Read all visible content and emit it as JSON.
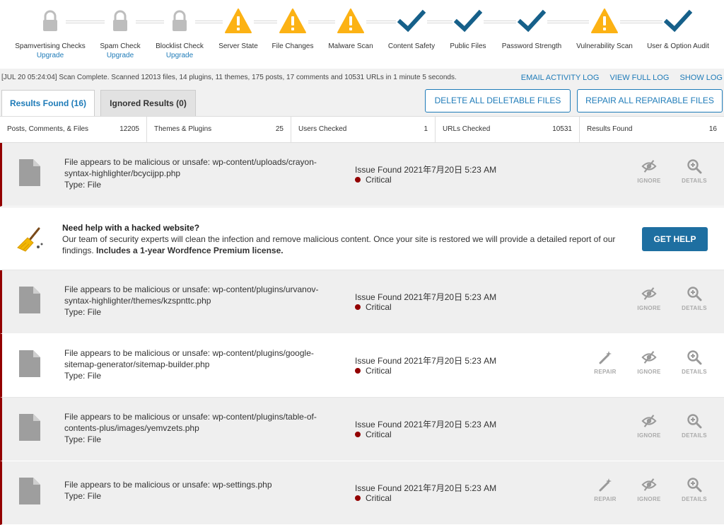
{
  "stages": [
    {
      "label": "Spamvertising Checks",
      "status": "locked",
      "icon": "lock-icon",
      "upgrade": "Upgrade"
    },
    {
      "label": "Spam Check",
      "status": "locked",
      "icon": "lock-icon",
      "upgrade": "Upgrade"
    },
    {
      "label": "Blocklist Check",
      "status": "locked",
      "icon": "lock-icon",
      "upgrade": "Upgrade"
    },
    {
      "label": "Server State",
      "status": "warning",
      "icon": "warning-icon"
    },
    {
      "label": "File Changes",
      "status": "warning",
      "icon": "warning-icon"
    },
    {
      "label": "Malware Scan",
      "status": "warning",
      "icon": "warning-icon"
    },
    {
      "label": "Content Safety",
      "status": "ok",
      "icon": "checkmark-icon"
    },
    {
      "label": "Public Files",
      "status": "ok",
      "icon": "checkmark-icon"
    },
    {
      "label": "Password Strength",
      "status": "ok",
      "icon": "checkmark-icon"
    },
    {
      "label": "Vulnerability Scan",
      "status": "warning",
      "icon": "warning-icon"
    },
    {
      "label": "User & Option Audit",
      "status": "ok",
      "icon": "checkmark-icon"
    }
  ],
  "log": {
    "message": "[JUL 20 05:24:04] Scan Complete. Scanned 12013 files, 14 plugins, 11 themes, 175 posts, 17 comments and 10531 URLs in 1 minute 5 seconds.",
    "email_activity": "EMAIL ACTIVITY LOG",
    "view_full": "VIEW FULL LOG",
    "show": "SHOW LOG"
  },
  "tabs": {
    "results": "Results Found (16)",
    "ignored": "Ignored Results (0)"
  },
  "actions": {
    "delete_all": "DELETE ALL DELETABLE FILES",
    "repair_all": "REPAIR ALL REPAIRABLE FILES"
  },
  "summary": [
    {
      "label": "Posts, Comments, & Files",
      "value": "12205"
    },
    {
      "label": "Themes & Plugins",
      "value": "25"
    },
    {
      "label": "Users Checked",
      "value": "1"
    },
    {
      "label": "URLs Checked",
      "value": "10531"
    },
    {
      "label": "Results Found",
      "value": "16"
    }
  ],
  "issues": [
    {
      "title": "File appears to be malicious or unsafe: wp-content/uploads/crayon-syntax-highlighter/bcycijpp.php",
      "type": "Type: File",
      "found": "Issue Found 2021年7月20日 5:23 AM",
      "severity": "Critical",
      "repair": false
    },
    {
      "title": "File appears to be malicious or unsafe: wp-content/plugins/urvanov-syntax-highlighter/themes/kzspnttc.php",
      "type": "Type: File",
      "found": "Issue Found 2021年7月20日 5:23 AM",
      "severity": "Critical",
      "repair": false
    },
    {
      "title": "File appears to be malicious or unsafe: wp-content/plugins/google-sitemap-generator/sitemap-builder.php",
      "type": "Type: File",
      "found": "Issue Found 2021年7月20日 5:23 AM",
      "severity": "Critical",
      "repair": true
    },
    {
      "title": "File appears to be malicious or unsafe: wp-content/plugins/table-of-contents-plus/images/yemvzets.php",
      "type": "Type: File",
      "found": "Issue Found 2021年7月20日 5:23 AM",
      "severity": "Critical",
      "repair": false
    },
    {
      "title": "File appears to be malicious or unsafe: wp-settings.php",
      "type": "Type: File",
      "found": "Issue Found 2021年7月20日 5:23 AM",
      "severity": "Critical",
      "repair": true
    }
  ],
  "issue_actions": {
    "repair": "REPAIR",
    "ignore": "IGNORE",
    "details": "DETAILS"
  },
  "help": {
    "heading": "Need help with a hacked website?",
    "text": "Our team of security experts will clean the infection and remove malicious content. Once your site is restored we will provide a detailed report of our findings.",
    "text_bold": "Includes a 1-year Wordfence Premium license.",
    "button": "GET HELP"
  },
  "colors": {
    "accent": "#1e7bb8",
    "button_dark": "#1e6fa1",
    "warning": "#fcb214",
    "check": "#16608a",
    "lock": "#bdbdbd",
    "critical": "#930000",
    "row_bg": "#efefef"
  }
}
